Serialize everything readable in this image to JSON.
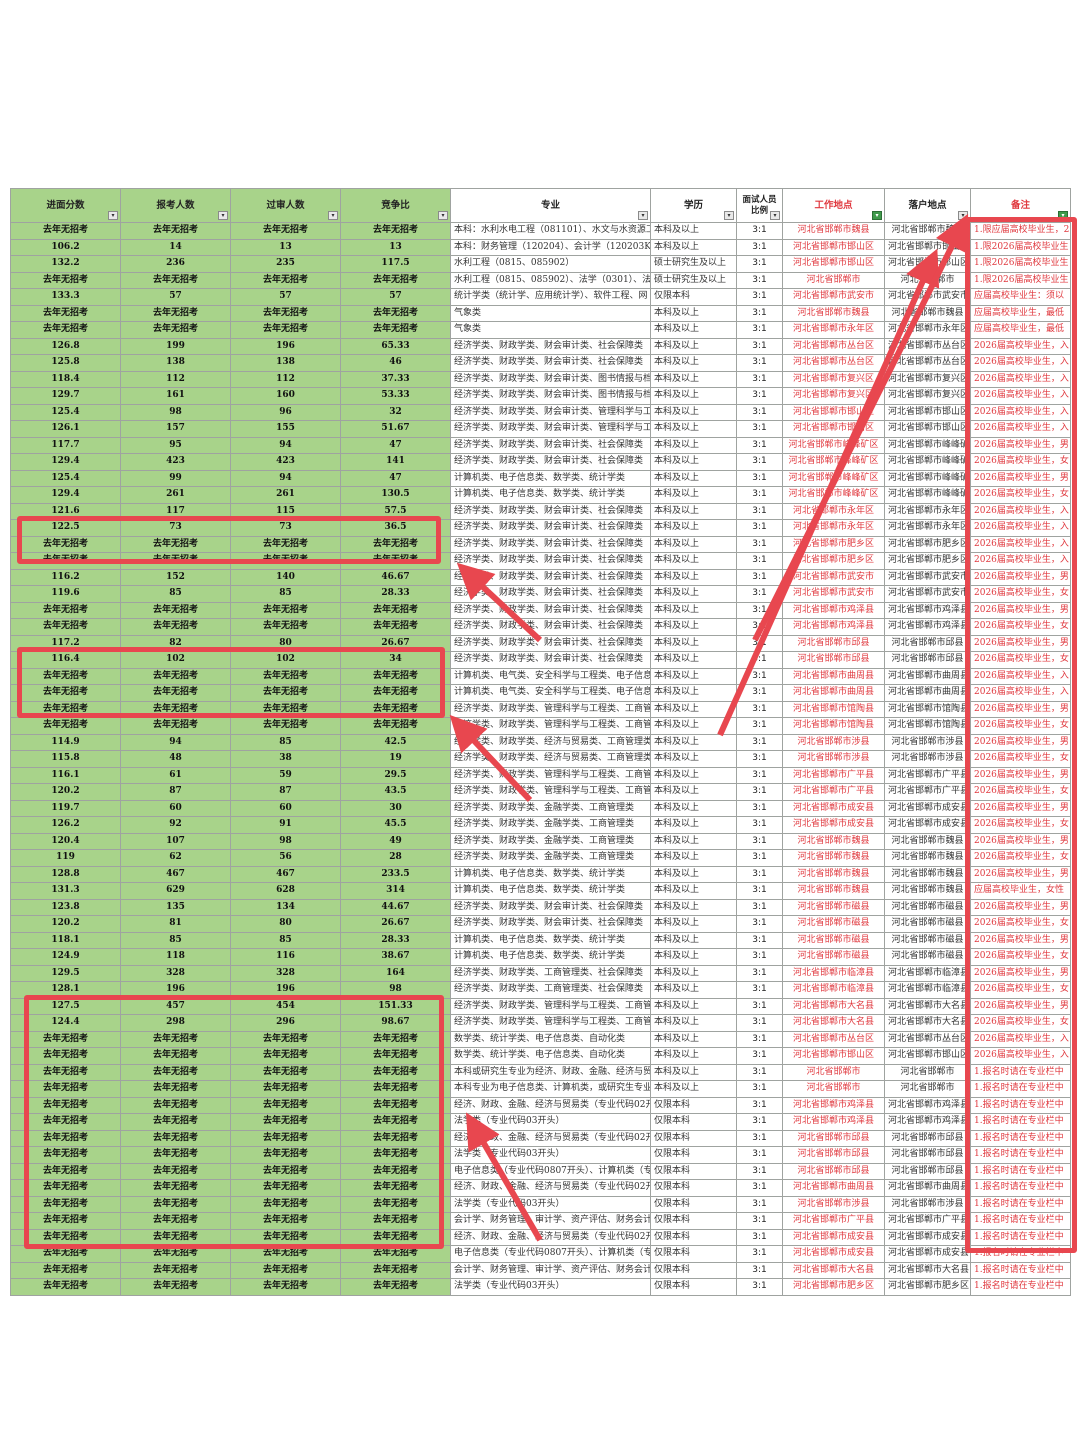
{
  "headers": [
    "进面分数",
    "报考人数",
    "过审人数",
    "竞争比",
    "专业",
    "学历",
    "面试人员比例",
    "工作地点",
    "落户地点",
    "备注"
  ],
  "rows": [
    [
      "去年无招考",
      "去年无招考",
      "去年无招考",
      "去年无招考",
      "本科：水利水电工程（081101）、水文与水资源工",
      "本科及以上",
      "3:1",
      "河北省邯郸市魏县",
      "河北省邯郸市魏县",
      "1.限应届高校毕业生，2"
    ],
    [
      "106.2",
      "14",
      "13",
      "13",
      "本科：财务管理（120204）、会计学（120203K）",
      "本科及以上",
      "3:1",
      "河北省邯郸市邯山区",
      "河北省邯郸市邯山区",
      "1.限2026届高校毕业生"
    ],
    [
      "132.2",
      "236",
      "235",
      "117.5",
      "水利工程（0815、085902）",
      "硕士研究生及以上",
      "3:1",
      "河北省邯郸市邯山区",
      "河北省邯郸市邯山区",
      "1.限2026届高校毕业生"
    ],
    [
      "去年无招考",
      "去年无招考",
      "去年无招考",
      "去年无招考",
      "水利工程（0815、085902）、法学（0301）、法律",
      "硕士研究生及以上",
      "3:1",
      "河北省邯郸市",
      "河北省邯郸市",
      "1.限2026届高校毕业生"
    ],
    [
      "133.3",
      "57",
      "57",
      "57",
      "统计学类（统计学、应用统计学）、软件工程、网",
      "仅限本科",
      "3:1",
      "河北省邯郸市武安市",
      "河北省邯郸市武安市",
      "应届高校毕业生：须以"
    ],
    [
      "去年无招考",
      "去年无招考",
      "去年无招考",
      "去年无招考",
      "气象类",
      "本科及以上",
      "3:1",
      "河北省邯郸市魏县",
      "河北省邯郸市魏县",
      "应届高校毕业生，最低"
    ],
    [
      "去年无招考",
      "去年无招考",
      "去年无招考",
      "去年无招考",
      "气象类",
      "本科及以上",
      "3:1",
      "河北省邯郸市永年区",
      "河北省邯郸市永年区",
      "应届高校毕业生，最低"
    ],
    [
      "126.8",
      "199",
      "196",
      "65.33",
      "经济学类、财政学类、财会审计类、社会保障类",
      "本科及以上",
      "3:1",
      "河北省邯郸市丛台区",
      "河北省邯郸市丛台区",
      "2026届高校毕业生，入"
    ],
    [
      "125.8",
      "138",
      "138",
      "46",
      "经济学类、财政学类、财会审计类、社会保障类",
      "本科及以上",
      "3:1",
      "河北省邯郸市丛台区",
      "河北省邯郸市丛台区",
      "2026届高校毕业生，入"
    ],
    [
      "118.4",
      "112",
      "112",
      "37.33",
      "经济学类、财政学类、财会审计类、图书情报与档",
      "本科及以上",
      "3:1",
      "河北省邯郸市复兴区",
      "河北省邯郸市复兴区",
      "2026届高校毕业生，入"
    ],
    [
      "129.7",
      "161",
      "160",
      "53.33",
      "经济学类、财政学类、财会审计类、图书情报与档",
      "本科及以上",
      "3:1",
      "河北省邯郸市复兴区",
      "河北省邯郸市复兴区",
      "2026届高校毕业生，入"
    ],
    [
      "125.4",
      "98",
      "96",
      "32",
      "经济学类、财政学类、财会审计类、管理科学与工",
      "本科及以上",
      "3:1",
      "河北省邯郸市邯山区",
      "河北省邯郸市邯山区",
      "2026届高校毕业生，入"
    ],
    [
      "126.1",
      "157",
      "155",
      "51.67",
      "经济学类、财政学类、财会审计类、管理科学与工",
      "本科及以上",
      "3:1",
      "河北省邯郸市邯山区",
      "河北省邯郸市邯山区",
      "2026届高校毕业生，入"
    ],
    [
      "117.7",
      "95",
      "94",
      "47",
      "经济学类、财政学类、财会审计类、社会保障类",
      "本科及以上",
      "3:1",
      "河北省邯郸市峰峰矿区",
      "河北省邯郸市峰峰矿区",
      "2026届高校毕业生，男"
    ],
    [
      "129.4",
      "423",
      "423",
      "141",
      "经济学类、财政学类、财会审计类、社会保障类",
      "本科及以上",
      "3:1",
      "河北省邯郸市峰峰矿区",
      "河北省邯郸市峰峰矿区",
      "2026届高校毕业生，女"
    ],
    [
      "125.4",
      "99",
      "94",
      "47",
      "计算机类、电子信息类、数学类、统计学类",
      "本科及以上",
      "3:1",
      "河北省邯郸市峰峰矿区",
      "河北省邯郸市峰峰矿区",
      "2026届高校毕业生，男"
    ],
    [
      "129.4",
      "261",
      "261",
      "130.5",
      "计算机类、电子信息类、数学类、统计学类",
      "本科及以上",
      "3:1",
      "河北省邯郸市峰峰矿区",
      "河北省邯郸市峰峰矿区",
      "2026届高校毕业生，女"
    ],
    [
      "121.6",
      "117",
      "115",
      "57.5",
      "经济学类、财政学类、财会审计类、社会保障类",
      "本科及以上",
      "3:1",
      "河北省邯郸市永年区",
      "河北省邯郸市永年区",
      "2026届高校毕业生，入"
    ],
    [
      "122.5",
      "73",
      "73",
      "36.5",
      "经济学类、财政学类、财会审计类、社会保障类",
      "本科及以上",
      "3:1",
      "河北省邯郸市永年区",
      "河北省邯郸市永年区",
      "2026届高校毕业生，入"
    ],
    [
      "去年无招考",
      "去年无招考",
      "去年无招考",
      "去年无招考",
      "经济学类、财政学类、财会审计类、社会保障类",
      "本科及以上",
      "3:1",
      "河北省邯郸市肥乡区",
      "河北省邯郸市肥乡区",
      "2026届高校毕业生，入"
    ],
    [
      "去年无招考",
      "去年无招考",
      "去年无招考",
      "去年无招考",
      "经济学类、财政学类、财会审计类、社会保障类",
      "本科及以上",
      "3:1",
      "河北省邯郸市肥乡区",
      "河北省邯郸市肥乡区",
      "2026届高校毕业生，入"
    ],
    [
      "116.2",
      "152",
      "140",
      "46.67",
      "经济学类、财政学类、财会审计类、社会保障类",
      "本科及以上",
      "3:1",
      "河北省邯郸市武安市",
      "河北省邯郸市武安市",
      "2026届高校毕业生，男"
    ],
    [
      "119.6",
      "85",
      "85",
      "28.33",
      "经济学类、财政学类、财会审计类、社会保障类",
      "本科及以上",
      "3:1",
      "河北省邯郸市武安市",
      "河北省邯郸市武安市",
      "2026届高校毕业生，女"
    ],
    [
      "去年无招考",
      "去年无招考",
      "去年无招考",
      "去年无招考",
      "经济学类、财政学类、财会审计类、社会保障类",
      "本科及以上",
      "3:1",
      "河北省邯郸市鸡泽县",
      "河北省邯郸市鸡泽县",
      "2026届高校毕业生，男"
    ],
    [
      "去年无招考",
      "去年无招考",
      "去年无招考",
      "去年无招考",
      "经济学类、财政学类、财会审计类、社会保障类",
      "本科及以上",
      "3:1",
      "河北省邯郸市鸡泽县",
      "河北省邯郸市鸡泽县",
      "2026届高校毕业生，女"
    ],
    [
      "117.2",
      "82",
      "80",
      "26.67",
      "经济学类、财政学类、财会审计类、社会保障类",
      "本科及以上",
      "3:1",
      "河北省邯郸市邱县",
      "河北省邯郸市邱县",
      "2026届高校毕业生，男"
    ],
    [
      "116.4",
      "102",
      "102",
      "34",
      "经济学类、财政学类、财会审计类、社会保障类",
      "本科及以上",
      "3:1",
      "河北省邯郸市邱县",
      "河北省邯郸市邱县",
      "2026届高校毕业生，女"
    ],
    [
      "去年无招考",
      "去年无招考",
      "去年无招考",
      "去年无招考",
      "计算机类、电气类、安全科学与工程类、电子信息",
      "本科及以上",
      "3:1",
      "河北省邯郸市曲周县",
      "河北省邯郸市曲周县",
      "2026届高校毕业生，入"
    ],
    [
      "去年无招考",
      "去年无招考",
      "去年无招考",
      "去年无招考",
      "计算机类、电气类、安全科学与工程类、电子信息",
      "本科及以上",
      "3:1",
      "河北省邯郸市曲周县",
      "河北省邯郸市曲周县",
      "2026届高校毕业生，入"
    ],
    [
      "去年无招考",
      "去年无招考",
      "去年无招考",
      "去年无招考",
      "经济学类、财政学类、管理科学与工程类、工商管",
      "本科及以上",
      "3:1",
      "河北省邯郸市馆陶县",
      "河北省邯郸市馆陶县",
      "2026届高校毕业生，男"
    ],
    [
      "去年无招考",
      "去年无招考",
      "去年无招考",
      "去年无招考",
      "经济学类、财政学类、管理科学与工程类、工商管",
      "本科及以上",
      "3:1",
      "河北省邯郸市馆陶县",
      "河北省邯郸市馆陶县",
      "2026届高校毕业生，女"
    ],
    [
      "114.9",
      "94",
      "85",
      "42.5",
      "经济学类、财政学类、经济与贸易类、工商管理类",
      "本科及以上",
      "3:1",
      "河北省邯郸市涉县",
      "河北省邯郸市涉县",
      "2026届高校毕业生，男"
    ],
    [
      "115.8",
      "48",
      "38",
      "19",
      "经济学类、财政学类、经济与贸易类、工商管理类",
      "本科及以上",
      "3:1",
      "河北省邯郸市涉县",
      "河北省邯郸市涉县",
      "2026届高校毕业生，女"
    ],
    [
      "116.1",
      "61",
      "59",
      "29.5",
      "经济学类、财政学类、管理科学与工程类、工商管",
      "本科及以上",
      "3:1",
      "河北省邯郸市广平县",
      "河北省邯郸市广平县",
      "2026届高校毕业生，男"
    ],
    [
      "120.2",
      "87",
      "87",
      "43.5",
      "经济学类、财政学类、管理科学与工程类、工商管",
      "本科及以上",
      "3:1",
      "河北省邯郸市广平县",
      "河北省邯郸市广平县",
      "2026届高校毕业生，女"
    ],
    [
      "119.7",
      "60",
      "60",
      "30",
      "经济学类、财政学类、金融学类、工商管理类",
      "本科及以上",
      "3:1",
      "河北省邯郸市成安县",
      "河北省邯郸市成安县",
      "2026届高校毕业生，男"
    ],
    [
      "126.2",
      "92",
      "91",
      "45.5",
      "经济学类、财政学类、金融学类、工商管理类",
      "本科及以上",
      "3:1",
      "河北省邯郸市成安县",
      "河北省邯郸市成安县",
      "2026届高校毕业生，女"
    ],
    [
      "120.4",
      "107",
      "98",
      "49",
      "经济学类、财政学类、金融学类、工商管理类",
      "本科及以上",
      "3:1",
      "河北省邯郸市魏县",
      "河北省邯郸市魏县",
      "2026届高校毕业生，男"
    ],
    [
      "119",
      "62",
      "56",
      "28",
      "经济学类、财政学类、金融学类、工商管理类",
      "本科及以上",
      "3:1",
      "河北省邯郸市魏县",
      "河北省邯郸市魏县",
      "2026届高校毕业生，女"
    ],
    [
      "128.8",
      "467",
      "467",
      "233.5",
      "计算机类、电子信息类、数学类、统计学类",
      "本科及以上",
      "3:1",
      "河北省邯郸市魏县",
      "河北省邯郸市魏县",
      "2026届高校毕业生，男"
    ],
    [
      "131.3",
      "629",
      "628",
      "314",
      "计算机类、电子信息类、数学类、统计学类",
      "本科及以上",
      "3:1",
      "河北省邯郸市魏县",
      "河北省邯郸市魏县",
      "应届高校毕业生，女性"
    ],
    [
      "123.8",
      "135",
      "134",
      "44.67",
      "经济学类、财政学类、财会审计类、社会保障类",
      "本科及以上",
      "3:1",
      "河北省邯郸市磁县",
      "河北省邯郸市磁县",
      "2026届高校毕业生，男"
    ],
    [
      "120.2",
      "81",
      "80",
      "26.67",
      "经济学类、财政学类、财会审计类、社会保障类",
      "本科及以上",
      "3:1",
      "河北省邯郸市磁县",
      "河北省邯郸市磁县",
      "2026届高校毕业生，女"
    ],
    [
      "118.1",
      "85",
      "85",
      "28.33",
      "计算机类、电子信息类、数学类、统计学类",
      "本科及以上",
      "3:1",
      "河北省邯郸市磁县",
      "河北省邯郸市磁县",
      "2026届高校毕业生，男"
    ],
    [
      "124.9",
      "118",
      "116",
      "38.67",
      "计算机类、电子信息类、数学类、统计学类",
      "本科及以上",
      "3:1",
      "河北省邯郸市磁县",
      "河北省邯郸市磁县",
      "2026届高校毕业生，女"
    ],
    [
      "129.5",
      "328",
      "328",
      "164",
      "经济学类、财政学类、工商管理类、社会保障类",
      "本科及以上",
      "3:1",
      "河北省邯郸市临漳县",
      "河北省邯郸市临漳县",
      "2026届高校毕业生，男"
    ],
    [
      "128.1",
      "196",
      "196",
      "98",
      "经济学类、财政学类、工商管理类、社会保障类",
      "本科及以上",
      "3:1",
      "河北省邯郸市临漳县",
      "河北省邯郸市临漳县",
      "2026届高校毕业生，女"
    ],
    [
      "127.5",
      "457",
      "454",
      "151.33",
      "经济学类、财政学类、管理科学与工程类、工商管",
      "本科及以上",
      "3:1",
      "河北省邯郸市大名县",
      "河北省邯郸市大名县",
      "2026届高校毕业生，男"
    ],
    [
      "124.4",
      "298",
      "296",
      "98.67",
      "经济学类、财政学类、管理科学与工程类、工商管",
      "本科及以上",
      "3:1",
      "河北省邯郸市大名县",
      "河北省邯郸市大名县",
      "2026届高校毕业生，女"
    ],
    [
      "去年无招考",
      "去年无招考",
      "去年无招考",
      "去年无招考",
      "数学类、统计学类、电子信息类、自动化类",
      "本科及以上",
      "3:1",
      "河北省邯郸市丛台区",
      "河北省邯郸市丛台区",
      "2026届高校毕业生，入"
    ],
    [
      "去年无招考",
      "去年无招考",
      "去年无招考",
      "去年无招考",
      "数学类、统计学类、电子信息类、自动化类",
      "本科及以上",
      "3:1",
      "河北省邯郸市邯山区",
      "河北省邯郸市邯山区",
      "2026届高校毕业生，入"
    ],
    [
      "去年无招考",
      "去年无招考",
      "去年无招考",
      "去年无招考",
      "本科或研究生专业为经济、财政、金融、经济与贸",
      "本科及以上",
      "3:1",
      "河北省邯郸市",
      "河北省邯郸市",
      "1.报名时请在专业栏中"
    ],
    [
      "去年无招考",
      "去年无招考",
      "去年无招考",
      "去年无招考",
      "本科专业为电子信息类、计算机类，或研究生专业",
      "本科及以上",
      "3:1",
      "河北省邯郸市",
      "河北省邯郸市",
      "1.报名时请在专业栏中"
    ],
    [
      "去年无招考",
      "去年无招考",
      "去年无招考",
      "去年无招考",
      "经济、财政、金融、经济与贸易类（专业代码02开",
      "仅限本科",
      "3:1",
      "河北省邯郸市鸡泽县",
      "河北省邯郸市鸡泽县",
      "1.报名时请在专业栏中"
    ],
    [
      "去年无招考",
      "去年无招考",
      "去年无招考",
      "去年无招考",
      "法学类（专业代码03开头）",
      "仅限本科",
      "3:1",
      "河北省邯郸市鸡泽县",
      "河北省邯郸市鸡泽县",
      "1.报名时请在专业栏中"
    ],
    [
      "去年无招考",
      "去年无招考",
      "去年无招考",
      "去年无招考",
      "经济、财政、金融、经济与贸易类（专业代码02开",
      "仅限本科",
      "3:1",
      "河北省邯郸市邱县",
      "河北省邯郸市邱县",
      "1.报名时请在专业栏中"
    ],
    [
      "去年无招考",
      "去年无招考",
      "去年无招考",
      "去年无招考",
      "法学类（专业代码03开头）",
      "仅限本科",
      "3:1",
      "河北省邯郸市邱县",
      "河北省邯郸市邱县",
      "1.报名时请在专业栏中"
    ],
    [
      "去年无招考",
      "去年无招考",
      "去年无招考",
      "去年无招考",
      "电子信息类（专业代码0807开头）、计算机类（专",
      "仅限本科",
      "3:1",
      "河北省邯郸市邱县",
      "河北省邯郸市邱县",
      "1.报名时请在专业栏中"
    ],
    [
      "去年无招考",
      "去年无招考",
      "去年无招考",
      "去年无招考",
      "经济、财政、金融、经济与贸易类（专业代码02开",
      "仅限本科",
      "3:1",
      "河北省邯郸市曲周县",
      "河北省邯郸市曲周县",
      "1.报名时请在专业栏中"
    ],
    [
      "去年无招考",
      "去年无招考",
      "去年无招考",
      "去年无招考",
      "法学类（专业代码03开头）",
      "仅限本科",
      "3:1",
      "河北省邯郸市涉县",
      "河北省邯郸市涉县",
      "1.报名时请在专业栏中"
    ],
    [
      "去年无招考",
      "去年无招考",
      "去年无招考",
      "去年无招考",
      "会计学、财务管理、审计学、资产评估、财务会计",
      "仅限本科",
      "3:1",
      "河北省邯郸市广平县",
      "河北省邯郸市广平县",
      "1.报名时请在专业栏中"
    ],
    [
      "去年无招考",
      "去年无招考",
      "去年无招考",
      "去年无招考",
      "经济、财政、金融、经济与贸易类（专业代码02开",
      "仅限本科",
      "3:1",
      "河北省邯郸市成安县",
      "河北省邯郸市成安县",
      "1.报名时请在专业栏中"
    ],
    [
      "去年无招考",
      "去年无招考",
      "去年无招考",
      "去年无招考",
      "电子信息类（专业代码0807开头）、计算机类（专",
      "仅限本科",
      "3:1",
      "河北省邯郸市成安县",
      "河北省邯郸市成安县",
      "1.报名时请在专业栏中"
    ],
    [
      "去年无招考",
      "去年无招考",
      "去年无招考",
      "去年无招考",
      "会计学、财务管理、审计学、资产评估、财务会计",
      "仅限本科",
      "3:1",
      "河北省邯郸市大名县",
      "河北省邯郸市大名县",
      "1.报名时请在专业栏中"
    ],
    [
      "去年无招考",
      "去年无招考",
      "去年无招考",
      "去年无招考",
      "法学类（专业代码03开头）",
      "仅限本科",
      "3:1",
      "河北省邯郸市肥乡区",
      "河北省邯郸市肥乡区",
      "1.报名时请在专业栏中"
    ]
  ],
  "colors": {
    "green_fill": "#a8d38a",
    "highlight_red": "#e8474f",
    "red_text": "#e0393f"
  }
}
